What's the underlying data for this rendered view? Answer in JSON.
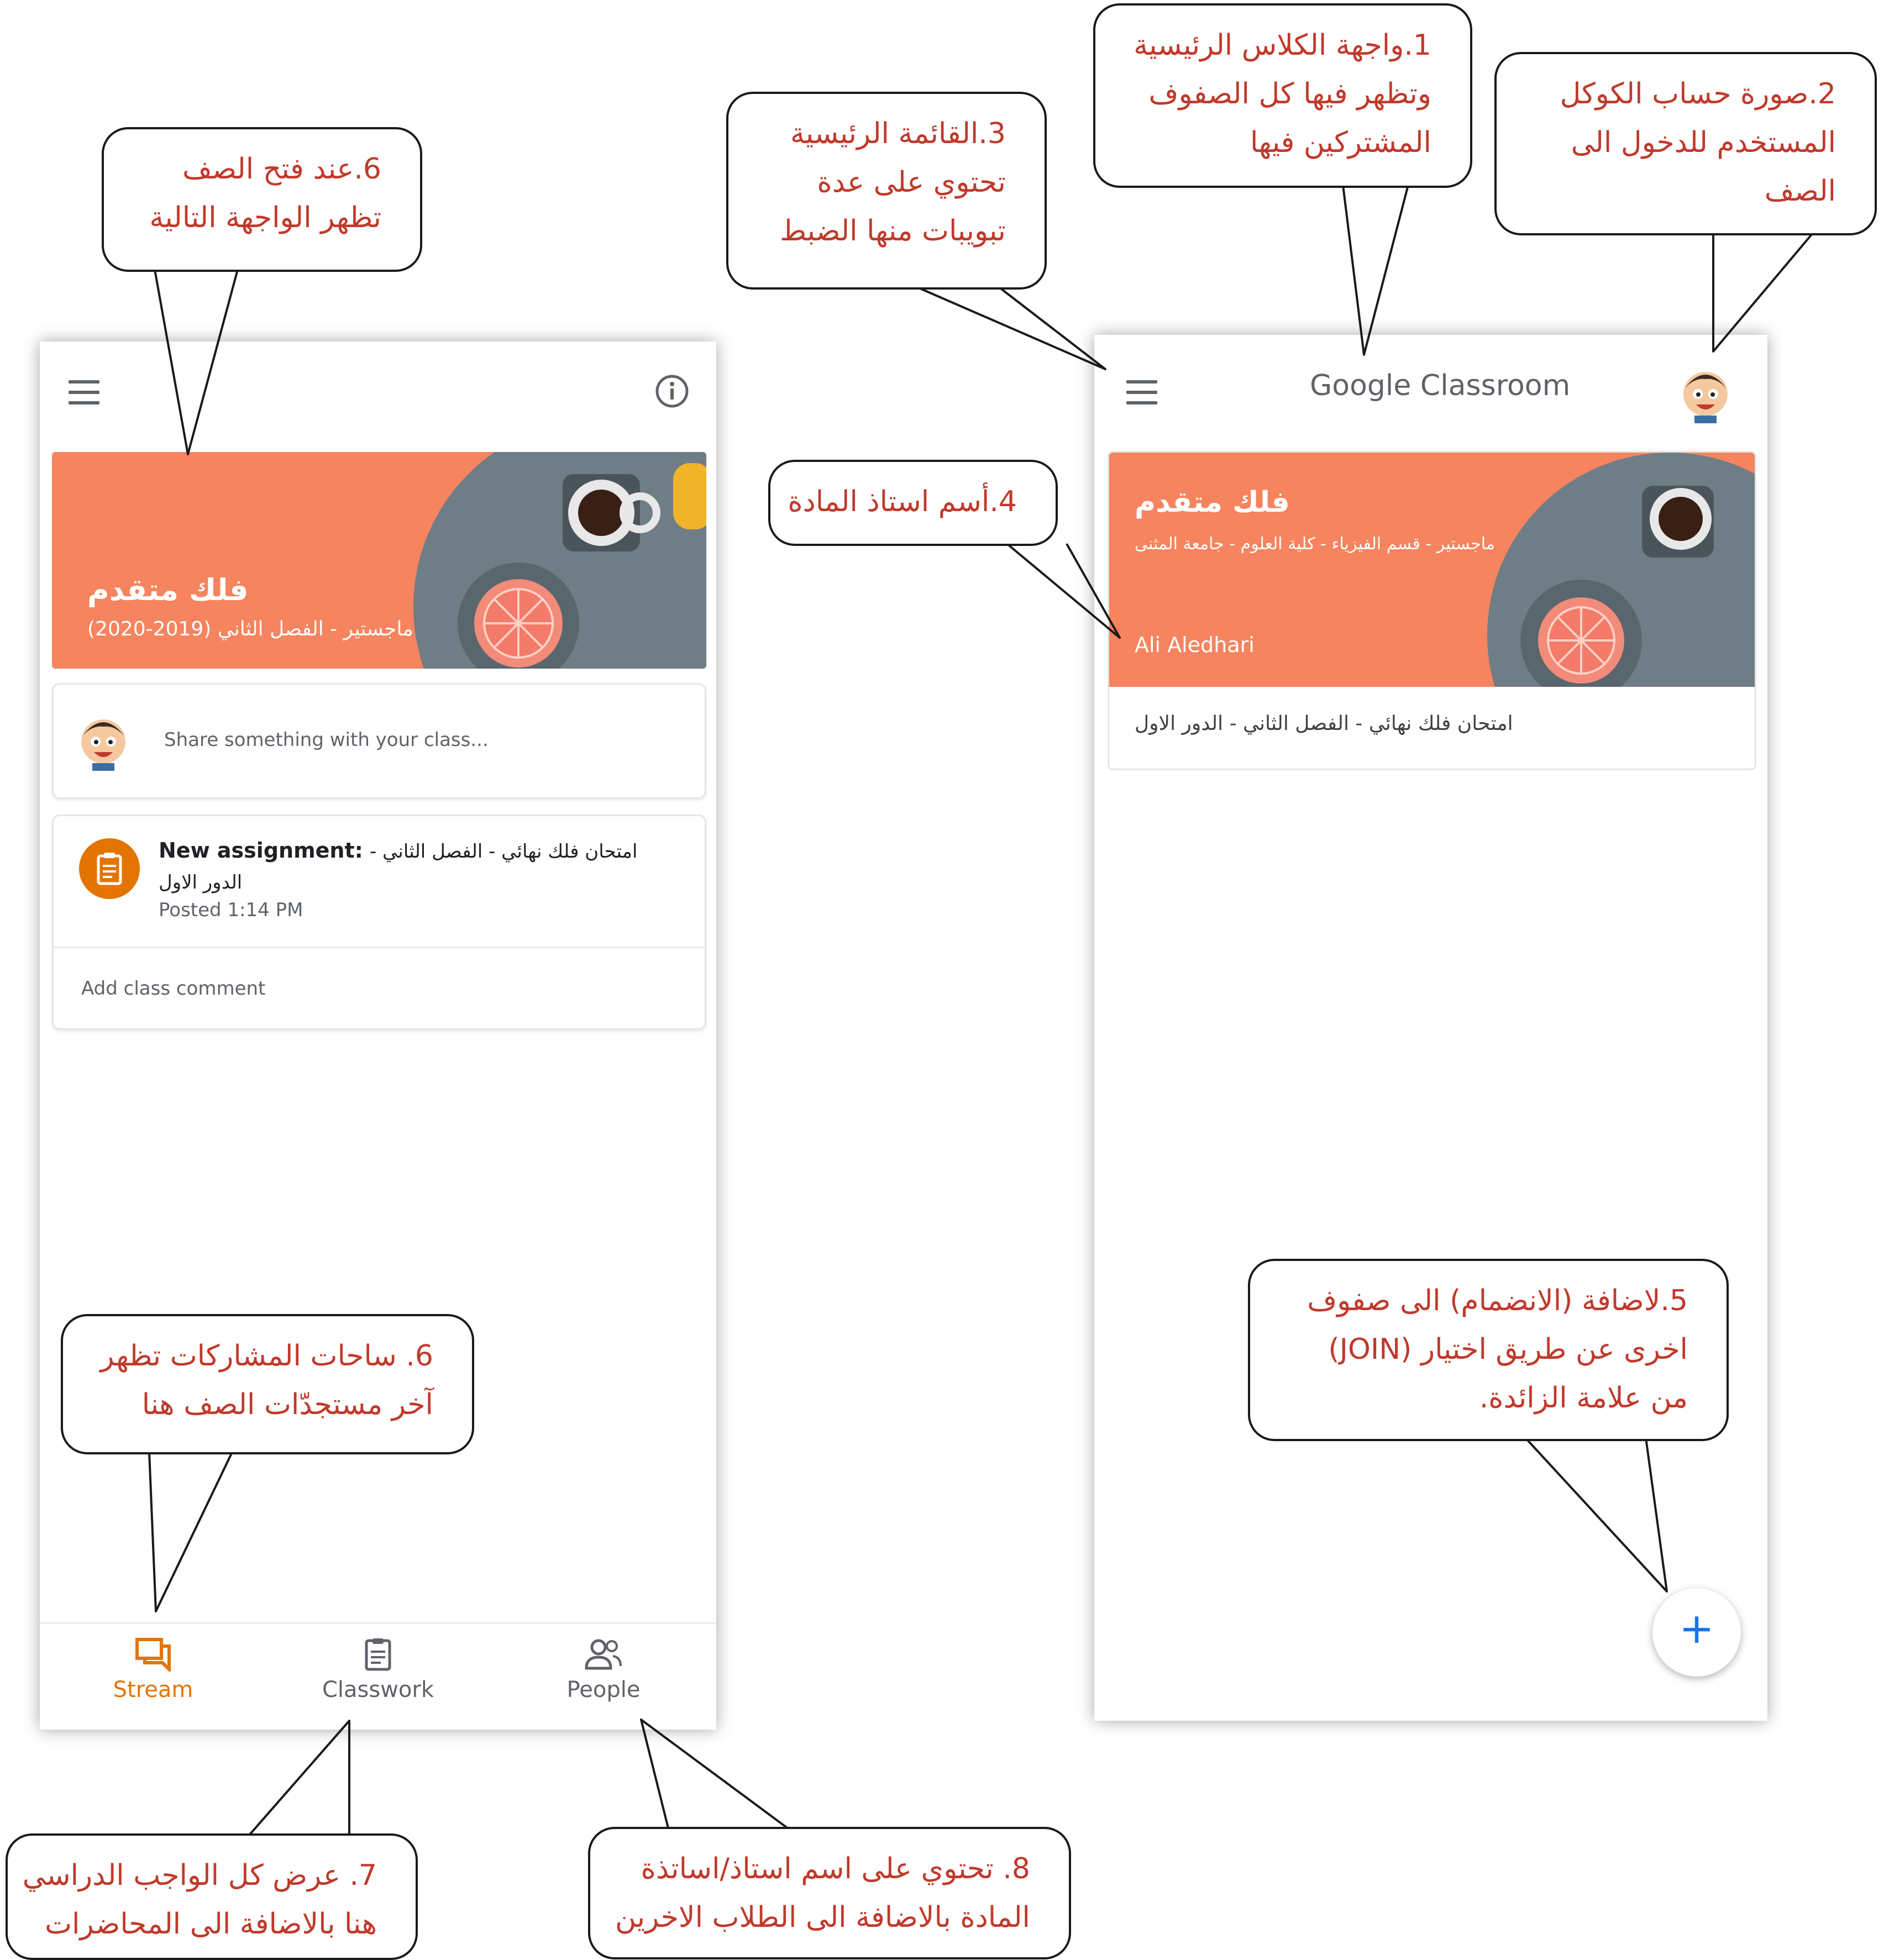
{
  "left_phone": {
    "class_banner": {
      "title": "فلك متقدم",
      "subtitle": "ماجستير - الفصل الثاني (2019-2020)"
    },
    "share_placeholder": "Share something with your class...",
    "post": {
      "prefix": "New assignment:",
      "text_line1": "امتحان فلك نهائي - الفصل الثاني -",
      "text_line2": "الدور الاول",
      "posted": "Posted 1:14 PM",
      "add_comment": "Add class comment"
    },
    "bottom_nav": [
      {
        "label": "Stream",
        "active": true
      },
      {
        "label": "Classwork",
        "active": false
      },
      {
        "label": "People",
        "active": false
      }
    ]
  },
  "right_phone": {
    "app_title": "Google Classroom",
    "class_card": {
      "title": "فلك متقدم",
      "subtitle": "ماجستير - قسم الفيزياء - كلية العلوم - جامعة المثنى",
      "teacher": "Ali Aledhari",
      "announcement": "امتحان فلك نهائي - الفصل الثاني - الدور الاول"
    },
    "fab_symbol": "+"
  },
  "callouts": {
    "c1": [
      "1.واجهة الكلاس الرئيسية",
      "وتظهر فيها كل الصفوف",
      "المشتركين فيها"
    ],
    "c2": [
      "2.صورة  حساب  الكوكل",
      "المستخدم  للدخول  الى",
      "الصف"
    ],
    "c3": [
      "3.القائمة الرئيسية",
      "تحتوي على عدة",
      "تبويبات منها الضبط"
    ],
    "c4": [
      "4.أسم استاذ المادة"
    ],
    "c5": [
      "5.لاضافة (الانضمام) الى صفوف",
      "اخرى  عن  طريق  اختيار  (JOIN)",
      "من علامة الزائدة."
    ],
    "c6a": [
      "6.عند  فتح  الصف",
      "تظهر الواجهة التالية"
    ],
    "c6b": [
      "6. ساحات المشاركات تظهر",
      "آخر مستجدّات الصف هنا"
    ],
    "c7": [
      "7. عرض كل الواجب الدراسي",
      "هنا  بالاضافة الى المحاضرات"
    ],
    "c8": [
      "8. تحتوي على اسم استاذ/اساتذة",
      "المادة بالاضافة الى الطلاب الاخرين"
    ]
  },
  "colors": {
    "banner": "#f5845f",
    "callout_text": "#c0392b",
    "active_nav": "#e37400",
    "fab_plus": "#1a73e8"
  },
  "icons": [
    "menu-icon",
    "info-icon",
    "avatar",
    "assignment-icon",
    "stream-icon",
    "classwork-icon",
    "people-icon",
    "add-icon"
  ]
}
